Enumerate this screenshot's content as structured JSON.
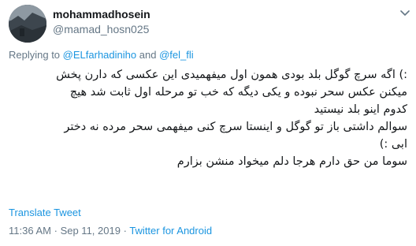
{
  "user": {
    "display_name": "mohammadhosein",
    "handle": "@mamad_hosn025"
  },
  "reply": {
    "prefix": "Replying to",
    "mention1": "@ELfarhadiniho",
    "joiner": "and",
    "mention2": "@fel_fli"
  },
  "tweet": {
    "lines": [
      ":) اگه سرچ گوگل بلد بودی همون اول میفهمیدی این عکسی که دارن پخش",
      "میکنن عکس سحر نبوده و یکی دیگه که خب تو مرحله اول ثابت شد هیچ",
      "کدوم اینو بلد نیستید",
      "سوالم داشتی باز تو گوگل و اینستا سرچ کنی میفهمی سحر مرده نه دختر",
      "ابی :)",
      "سوما من حق دارم هرجا دلم میخواد منشن بزارم"
    ]
  },
  "translate_label": "Translate Tweet",
  "meta": {
    "time": "11:36 AM",
    "separator": "·",
    "date": "Sep 11, 2019",
    "source": "Twitter for Android"
  },
  "icons": {
    "menu": "chevron-down-icon",
    "avatar": "profile-avatar"
  },
  "colors": {
    "link": "#1b95e0",
    "secondary_text": "#657786",
    "primary_text": "#14171a"
  }
}
